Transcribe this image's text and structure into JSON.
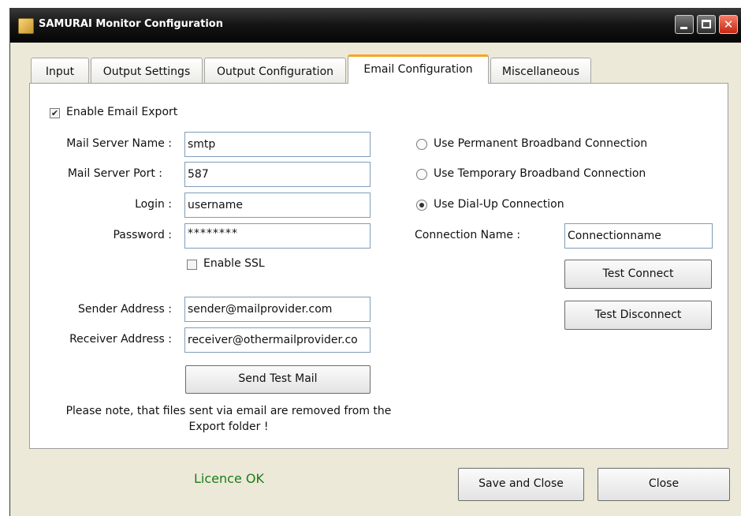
{
  "window": {
    "title": "SAMURAI Monitor Configuration"
  },
  "tabs": [
    {
      "label": "Input",
      "active": false
    },
    {
      "label": "Output Settings",
      "active": false
    },
    {
      "label": "Output Configuration",
      "active": false
    },
    {
      "label": "Email Configuration",
      "active": true
    },
    {
      "label": "Miscellaneous",
      "active": false
    }
  ],
  "email": {
    "enable_export": {
      "label": "Enable Email Export",
      "checked": true
    },
    "mail_server_name": {
      "label": "Mail Server Name :",
      "value": "smtp"
    },
    "mail_server_port": {
      "label": "Mail Server Port :",
      "value": "587"
    },
    "login": {
      "label": "Login :",
      "value": "username"
    },
    "password": {
      "label": "Password :",
      "value": "********"
    },
    "enable_ssl": {
      "label": "Enable SSL",
      "checked": false
    },
    "sender_address": {
      "label": "Sender Address :",
      "value": "sender@mailprovider.com"
    },
    "receiver_address": {
      "label": "Receiver Address :",
      "value": "receiver@othermailprovider.co"
    },
    "send_test_mail_label": "Send Test Mail",
    "note_line1": "Please note, that files sent via email are removed from the",
    "note_line2": "Export folder !"
  },
  "connection": {
    "options": [
      {
        "label": "Use Permanent Broadband Connection",
        "selected": false
      },
      {
        "label": "Use Temporary Broadband Connection",
        "selected": false
      },
      {
        "label": "Use Dial-Up Connection",
        "selected": true
      }
    ],
    "connection_name": {
      "label": "Connection Name :",
      "value": "Connectionname"
    },
    "test_connect_label": "Test Connect",
    "test_disconnect_label": "Test Disconnect"
  },
  "footer": {
    "licence_status": "Licence OK",
    "licence_color": "#1a7d18",
    "save_close_label": "Save and Close",
    "close_label": "Close"
  },
  "colors": {
    "active_tab_accent": "#f6a623",
    "titlebar": "#161616",
    "close_button": "#c7260e"
  }
}
